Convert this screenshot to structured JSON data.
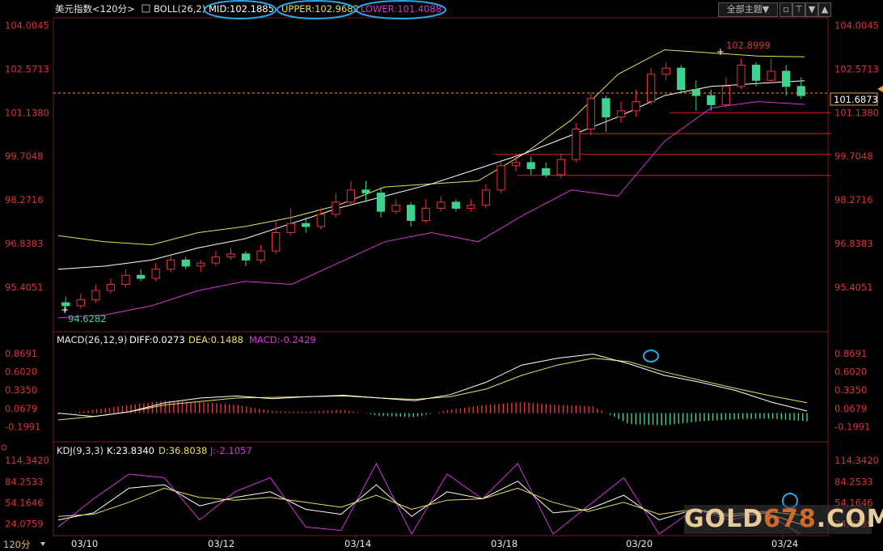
{
  "title_bar": {
    "instrument": "美元指数<120分>",
    "indicator": "BOLL(26,2)",
    "mid": "MID:102.1885",
    "upper": "UPPER:102.9682",
    "lower": "LOWER:101.4088",
    "theme_button": "全部主题▼"
  },
  "price_panel": {
    "ticks": [
      "104.0045",
      "102.5713",
      "101.1380",
      "99.7048",
      "98.2716",
      "96.8383",
      "95.4051"
    ],
    "current_price": "101.6873",
    "high_label": "102.8999",
    "low_label": "94.6282"
  },
  "macd_panel": {
    "name": "MACD(26,12,9)",
    "diff": "DIFF:0.0273",
    "dea": "DEA:0.1488",
    "macd": "MACD:-0.2429",
    "ticks": [
      "0.8691",
      "0.6020",
      "0.3350",
      "0.0679",
      "-0.1991"
    ]
  },
  "kdj_panel": {
    "name": "KDJ(9,3,3)",
    "k": "K:23.8340",
    "d": "D:36.8038",
    "j": "J:-2.1057",
    "ticks": [
      "114.3420",
      "84.2533",
      "54.1646",
      "24.0759"
    ]
  },
  "x_axis": {
    "period_label": "120分",
    "dates": [
      "03/10",
      "03/12",
      "03/14",
      "03/18",
      "03/20",
      "03/24"
    ]
  },
  "watermark": {
    "part1": "GOLD",
    "part2": "678",
    "part3": ".COM"
  },
  "colors": {
    "up": "#e8333a",
    "down": "#3fd18f",
    "mid_line": "#ffffff",
    "upper_line": "#e8e05a",
    "lower_line": "#d535d5",
    "axis_text": "#e0303a",
    "highlight_ellipse": "#28a8e8",
    "dea_line": "#e8e05a",
    "diff_line": "#ffffff",
    "j_line": "#d535d5",
    "k_line": "#ffffff",
    "d_line": "#e8e05a"
  },
  "chart_data": {
    "type": "candlestick",
    "y_range": [
      94.0,
      104.2
    ],
    "support_levels": [
      101.14,
      100.45,
      99.77,
      99.08
    ],
    "boll_mid": [
      96.0,
      96.1,
      96.3,
      96.7,
      97.0,
      97.5,
      98.0,
      98.4,
      98.8,
      99.3,
      99.8,
      100.4,
      101.0,
      101.7,
      102.0,
      102.1,
      102.19
    ],
    "boll_upper": [
      97.1,
      96.9,
      96.8,
      97.2,
      97.4,
      97.7,
      98.1,
      98.7,
      98.8,
      98.9,
      99.8,
      100.9,
      102.4,
      103.2,
      103.1,
      103.0,
      102.97
    ],
    "boll_lower": [
      94.4,
      94.5,
      94.8,
      95.3,
      95.6,
      95.5,
      96.2,
      96.9,
      97.2,
      96.9,
      97.8,
      98.6,
      98.4,
      100.2,
      101.3,
      101.5,
      101.41
    ],
    "candles": [
      {
        "o": 94.9,
        "c": 94.8,
        "h": 95.1,
        "l": 94.6
      },
      {
        "o": 94.8,
        "c": 95.0,
        "h": 95.2,
        "l": 94.7
      },
      {
        "o": 95.0,
        "c": 95.3,
        "h": 95.5,
        "l": 94.9
      },
      {
        "o": 95.3,
        "c": 95.5,
        "h": 95.7,
        "l": 95.2
      },
      {
        "o": 95.5,
        "c": 95.8,
        "h": 96.0,
        "l": 95.4
      },
      {
        "o": 95.8,
        "c": 95.7,
        "h": 96.0,
        "l": 95.6
      },
      {
        "o": 95.7,
        "c": 96.0,
        "h": 96.2,
        "l": 95.6
      },
      {
        "o": 96.0,
        "c": 96.3,
        "h": 96.5,
        "l": 95.9
      },
      {
        "o": 96.3,
        "c": 96.1,
        "h": 96.4,
        "l": 96.0
      },
      {
        "o": 96.1,
        "c": 96.2,
        "h": 96.3,
        "l": 95.9
      },
      {
        "o": 96.2,
        "c": 96.4,
        "h": 96.6,
        "l": 96.1
      },
      {
        "o": 96.4,
        "c": 96.5,
        "h": 96.7,
        "l": 96.3
      },
      {
        "o": 96.5,
        "c": 96.3,
        "h": 96.6,
        "l": 96.1
      },
      {
        "o": 96.3,
        "c": 96.6,
        "h": 96.8,
        "l": 96.2
      },
      {
        "o": 96.6,
        "c": 97.2,
        "h": 97.6,
        "l": 96.5
      },
      {
        "o": 97.2,
        "c": 97.5,
        "h": 98.0,
        "l": 97.1
      },
      {
        "o": 97.5,
        "c": 97.4,
        "h": 97.7,
        "l": 97.2
      },
      {
        "o": 97.4,
        "c": 97.8,
        "h": 98.0,
        "l": 97.3
      },
      {
        "o": 97.8,
        "c": 98.2,
        "h": 98.5,
        "l": 97.7
      },
      {
        "o": 98.2,
        "c": 98.6,
        "h": 98.9,
        "l": 98.1
      },
      {
        "o": 98.6,
        "c": 98.5,
        "h": 98.9,
        "l": 98.2
      },
      {
        "o": 98.5,
        "c": 97.9,
        "h": 98.7,
        "l": 97.7
      },
      {
        "o": 97.9,
        "c": 98.1,
        "h": 98.3,
        "l": 97.8
      },
      {
        "o": 98.1,
        "c": 97.6,
        "h": 98.2,
        "l": 97.4
      },
      {
        "o": 97.6,
        "c": 98.0,
        "h": 98.3,
        "l": 97.5
      },
      {
        "o": 98.0,
        "c": 98.2,
        "h": 98.4,
        "l": 97.9
      },
      {
        "o": 98.2,
        "c": 98.0,
        "h": 98.3,
        "l": 97.9
      },
      {
        "o": 98.0,
        "c": 98.1,
        "h": 98.3,
        "l": 97.9
      },
      {
        "o": 98.1,
        "c": 98.6,
        "h": 98.8,
        "l": 98.0
      },
      {
        "o": 98.6,
        "c": 99.4,
        "h": 99.6,
        "l": 98.5
      },
      {
        "o": 99.4,
        "c": 99.5,
        "h": 99.8,
        "l": 99.2
      },
      {
        "o": 99.5,
        "c": 99.3,
        "h": 99.7,
        "l": 99.1
      },
      {
        "o": 99.3,
        "c": 99.1,
        "h": 99.5,
        "l": 99.0
      },
      {
        "o": 99.1,
        "c": 99.6,
        "h": 99.8,
        "l": 99.0
      },
      {
        "o": 99.6,
        "c": 100.6,
        "h": 100.8,
        "l": 99.5
      },
      {
        "o": 100.6,
        "c": 101.6,
        "h": 101.8,
        "l": 100.4
      },
      {
        "o": 101.6,
        "c": 101.0,
        "h": 101.7,
        "l": 100.5
      },
      {
        "o": 101.0,
        "c": 101.2,
        "h": 101.5,
        "l": 100.8
      },
      {
        "o": 101.2,
        "c": 101.5,
        "h": 101.9,
        "l": 101.0
      },
      {
        "o": 101.5,
        "c": 102.4,
        "h": 102.6,
        "l": 101.4
      },
      {
        "o": 102.4,
        "c": 102.6,
        "h": 102.8,
        "l": 102.2
      },
      {
        "o": 102.6,
        "c": 101.9,
        "h": 102.7,
        "l": 101.8
      },
      {
        "o": 101.9,
        "c": 101.7,
        "h": 102.2,
        "l": 101.2
      },
      {
        "o": 101.7,
        "c": 101.4,
        "h": 101.9,
        "l": 101.2
      },
      {
        "o": 101.4,
        "c": 102.0,
        "h": 102.3,
        "l": 101.3
      },
      {
        "o": 102.0,
        "c": 102.7,
        "h": 102.9,
        "l": 101.9
      },
      {
        "o": 102.7,
        "c": 102.2,
        "h": 102.8,
        "l": 102.0
      },
      {
        "o": 102.2,
        "c": 102.5,
        "h": 102.9,
        "l": 102.1
      },
      {
        "o": 102.5,
        "c": 102.0,
        "h": 102.7,
        "l": 101.7
      },
      {
        "o": 102.0,
        "c": 101.7,
        "h": 102.3,
        "l": 101.6
      }
    ],
    "macd": {
      "diff": [
        0.0,
        -0.05,
        0.02,
        0.15,
        0.22,
        0.25,
        0.21,
        0.24,
        0.26,
        0.22,
        0.18,
        0.27,
        0.45,
        0.7,
        0.8,
        0.86,
        0.72,
        0.55,
        0.45,
        0.33,
        0.16,
        0.03
      ],
      "dea": [
        -0.1,
        -0.05,
        0.02,
        0.12,
        0.17,
        0.22,
        0.23,
        0.24,
        0.25,
        0.22,
        0.2,
        0.24,
        0.35,
        0.55,
        0.7,
        0.8,
        0.75,
        0.6,
        0.48,
        0.36,
        0.25,
        0.15
      ],
      "bars": [
        -0.02,
        0.05,
        0.12,
        0.18,
        0.16,
        0.12,
        0.03,
        0.02,
        0.05,
        -0.04,
        -0.06,
        0.05,
        0.12,
        0.16,
        0.12,
        0.1,
        -0.16,
        -0.18,
        -0.12,
        -0.09,
        -0.08,
        -0.12
      ]
    },
    "kdj": {
      "k": [
        30,
        40,
        75,
        80,
        50,
        62,
        70,
        45,
        38,
        80,
        35,
        70,
        60,
        85,
        40,
        45,
        65,
        30,
        45,
        35,
        40,
        24
      ],
      "d": [
        35,
        38,
        55,
        75,
        62,
        58,
        62,
        55,
        48,
        65,
        45,
        58,
        60,
        75,
        55,
        42,
        55,
        38,
        45,
        38,
        42,
        37
      ],
      "j": [
        20,
        60,
        95,
        90,
        30,
        70,
        90,
        20,
        15,
        110,
        10,
        95,
        60,
        110,
        10,
        50,
        90,
        10,
        45,
        30,
        40,
        -2
      ]
    }
  }
}
